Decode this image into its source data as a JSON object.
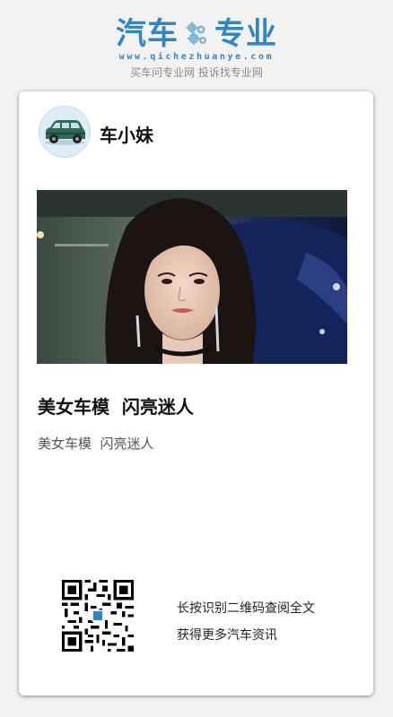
{
  "brand": {
    "name_left": "汽车",
    "name_right": "专业",
    "url": "www.qichezhuanye.com",
    "slogan": "买车问专业网 投诉找专业网",
    "color": "#2f86c4"
  },
  "author": {
    "name": "车小妹",
    "avatar_icon": "car-icon"
  },
  "article": {
    "image_icon": "photo-car-model",
    "title": "美女车模  闪亮迷人",
    "summary": "美女车模  闪亮迷人"
  },
  "footer": {
    "qr_icon": "qr-code-icon",
    "cta_line1": "长按识别二维码查阅全文",
    "cta_line2": "获得更多汽车资讯"
  }
}
